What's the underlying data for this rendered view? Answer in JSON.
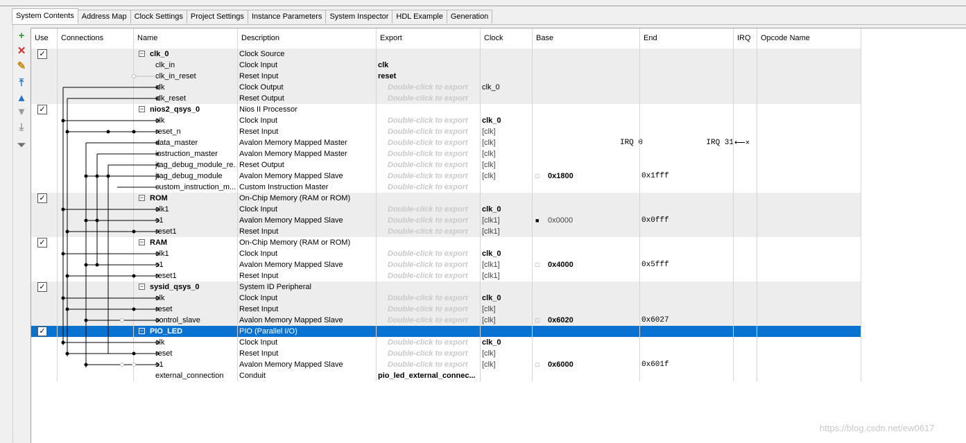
{
  "tabs": [
    "System Contents",
    "Address Map",
    "Clock Settings",
    "Project Settings",
    "Instance Parameters",
    "System Inspector",
    "HDL Example",
    "Generation"
  ],
  "toolbar": [
    {
      "icon": "add-icon",
      "glyph": "+",
      "color": "#2e9a2e"
    },
    {
      "icon": "remove-icon",
      "glyph": "✕",
      "color": "#d62a2a"
    },
    {
      "icon": "edit-icon",
      "glyph": "✎",
      "color": "#c98a1a"
    },
    {
      "icon": "move-top-icon",
      "glyph": "⤒",
      "color": "#2a6fc9"
    },
    {
      "icon": "move-up-icon",
      "glyph": "▲",
      "color": "#2a6fc9"
    },
    {
      "icon": "move-down-icon",
      "glyph": "▼",
      "color": "#9a9a9a"
    },
    {
      "icon": "move-bottom-icon",
      "glyph": "⤓",
      "color": "#9a9a9a"
    },
    {
      "icon": "filter-icon",
      "glyph": "⏷",
      "color": "#707070"
    }
  ],
  "columns": [
    "Use",
    "Connections",
    "Name",
    "Description",
    "Export",
    "Clock",
    "Base",
    "End",
    "IRQ",
    "Opcode Name"
  ],
  "rows": [
    {
      "kind": "comp",
      "checked": true,
      "name": "clk_0",
      "desc": "Clock Source",
      "export": "",
      "clock": "",
      "base": "",
      "end": "",
      "irq": ""
    },
    {
      "name": "clk_in",
      "desc": "Clock Input",
      "export": "clk",
      "exportBold": true,
      "clock": "",
      "base": "",
      "end": ""
    },
    {
      "name": "clk_in_reset",
      "desc": "Reset Input",
      "export": "reset",
      "exportBold": true,
      "clock": "",
      "base": "",
      "end": ""
    },
    {
      "name": "clk",
      "desc": "Clock Output",
      "export": "Double-click to export",
      "clock": "clk_0",
      "base": "",
      "end": ""
    },
    {
      "name": "clk_reset",
      "desc": "Reset Output",
      "export": "Double-click to export",
      "clock": "",
      "base": "",
      "end": ""
    },
    {
      "kind": "comp",
      "checked": true,
      "name": "nios2_qsys_0",
      "desc": "Nios II Processor",
      "export": "",
      "clock": "",
      "base": "",
      "end": ""
    },
    {
      "name": "clk",
      "desc": "Clock Input",
      "export": "Double-click to export",
      "clock": "clk_0",
      "clockBold": true,
      "base": "",
      "end": ""
    },
    {
      "name": "reset_n",
      "desc": "Reset Input",
      "export": "Double-click to export",
      "clock": "[clk]",
      "base": "",
      "end": ""
    },
    {
      "name": "data_master",
      "desc": "Avalon Memory Mapped Master",
      "export": "Double-click to export",
      "clock": "[clk]",
      "base": "",
      "end": "IRQ 0",
      "irq": "IRQ 31"
    },
    {
      "name": "instruction_master",
      "desc": "Avalon Memory Mapped Master",
      "export": "Double-click to export",
      "clock": "[clk]",
      "base": "",
      "end": ""
    },
    {
      "name": "jtag_debug_module_re...",
      "desc": "Reset Output",
      "export": "Double-click to export",
      "clock": "[clk]",
      "base": "",
      "end": ""
    },
    {
      "name": "jtag_debug_module",
      "desc": "Avalon Memory Mapped Slave",
      "export": "Double-click to export",
      "clock": "[clk]",
      "base": "0x1800",
      "baseBold": true,
      "lock": "open",
      "end": "0x1fff"
    },
    {
      "name": "custom_instruction_m...",
      "desc": "Custom Instruction Master",
      "export": "Double-click to export",
      "clock": "",
      "base": "",
      "end": ""
    },
    {
      "kind": "comp",
      "checked": true,
      "name": "ROM",
      "desc": "On-Chip Memory (RAM or ROM)",
      "export": "",
      "clock": "",
      "base": "",
      "end": ""
    },
    {
      "name": "clk1",
      "desc": "Clock Input",
      "export": "Double-click to export",
      "clock": "clk_0",
      "clockBold": true,
      "base": "",
      "end": ""
    },
    {
      "name": "s1",
      "desc": "Avalon Memory Mapped Slave",
      "export": "Double-click to export",
      "clock": "[clk1]",
      "base": "0x0000",
      "lock": "closed",
      "end": "0x0fff"
    },
    {
      "name": "reset1",
      "desc": "Reset Input",
      "export": "Double-click to export",
      "clock": "[clk1]",
      "base": "",
      "end": ""
    },
    {
      "kind": "comp",
      "checked": true,
      "name": "RAM",
      "desc": "On-Chip Memory (RAM or ROM)",
      "export": "",
      "clock": "",
      "base": "",
      "end": ""
    },
    {
      "name": "clk1",
      "desc": "Clock Input",
      "export": "Double-click to export",
      "clock": "clk_0",
      "clockBold": true,
      "base": "",
      "end": ""
    },
    {
      "name": "s1",
      "desc": "Avalon Memory Mapped Slave",
      "export": "Double-click to export",
      "clock": "[clk1]",
      "base": "0x4000",
      "baseBold": true,
      "lock": "open",
      "end": "0x5fff"
    },
    {
      "name": "reset1",
      "desc": "Reset Input",
      "export": "Double-click to export",
      "clock": "[clk1]",
      "base": "",
      "end": ""
    },
    {
      "kind": "comp",
      "checked": true,
      "name": "sysid_qsys_0",
      "desc": "System ID Peripheral",
      "export": "",
      "clock": "",
      "base": "",
      "end": ""
    },
    {
      "name": "clk",
      "desc": "Clock Input",
      "export": "Double-click to export",
      "clock": "clk_0",
      "clockBold": true,
      "base": "",
      "end": ""
    },
    {
      "name": "reset",
      "desc": "Reset Input",
      "export": "Double-click to export",
      "clock": "[clk]",
      "base": "",
      "end": ""
    },
    {
      "name": "control_slave",
      "desc": "Avalon Memory Mapped Slave",
      "export": "Double-click to export",
      "clock": "[clk]",
      "base": "0x6020",
      "baseBold": true,
      "lock": "open",
      "end": "0x6027"
    },
    {
      "kind": "comp",
      "checked": true,
      "selected": true,
      "name": "PIO_LED",
      "desc": "PIO (Parallel I/O)",
      "export": "",
      "clock": "",
      "base": "",
      "end": ""
    },
    {
      "name": "clk",
      "desc": "Clock Input",
      "export": "Double-click to export",
      "clock": "clk_0",
      "clockBold": true,
      "base": "",
      "end": ""
    },
    {
      "name": "reset",
      "desc": "Reset Input",
      "export": "Double-click to export",
      "clock": "[clk]",
      "base": "",
      "end": ""
    },
    {
      "name": "s1",
      "desc": "Avalon Memory Mapped Slave",
      "export": "Double-click to export",
      "clock": "[clk]",
      "base": "0x6000",
      "baseBold": true,
      "lock": "open",
      "end": "0x601f"
    },
    {
      "name": "external_connection",
      "desc": "Conduit",
      "export": "pio_led_external_connec...",
      "exportBold": true,
      "clock": "",
      "base": "",
      "end": ""
    }
  ],
  "watermark": "https://blog.csdn.net/ew0617"
}
